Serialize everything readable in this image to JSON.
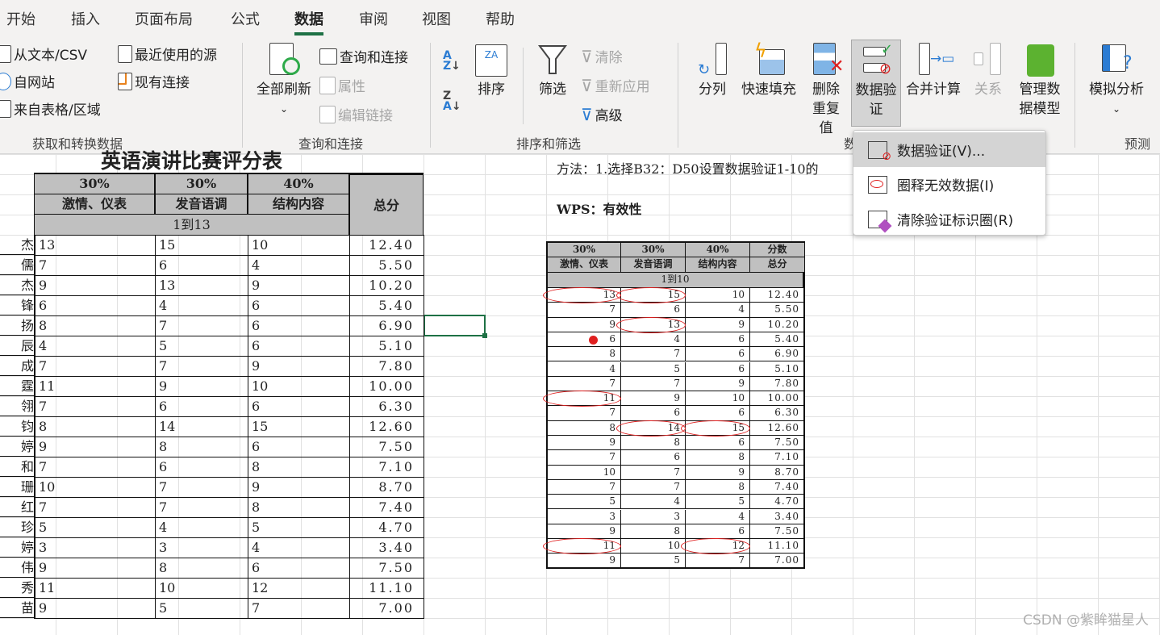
{
  "tabs": [
    "开始",
    "插入",
    "页面布局",
    "公式",
    "数据",
    "审阅",
    "视图",
    "帮助"
  ],
  "active_tab": "数据",
  "ribbon": {
    "get_transform": {
      "label": "获取和转换数据",
      "items": [
        "从文本/CSV",
        "自网站",
        "来自表格/区域",
        "最近使用的源",
        "现有连接"
      ]
    },
    "queries": {
      "label": "查询和连接",
      "refresh_all": "全部刷新",
      "items": [
        "查询和连接",
        "属性",
        "编辑链接"
      ]
    },
    "sort_filter": {
      "label": "排序和筛选",
      "sort": "排序",
      "filter": "筛选",
      "clear": "清除",
      "reapply": "重新应用",
      "advanced": "高级"
    },
    "data_tools": {
      "label": "数",
      "text_to_columns": "分列",
      "flash_fill": "快速填充",
      "remove_dup": "删除重复值",
      "data_validation": "数据验证",
      "consolidate": "合并计算",
      "relationships": "关系",
      "data_model": "管理数据模型"
    },
    "forecast": {
      "label": "预测",
      "what_if": "模拟分析"
    }
  },
  "dropdown": {
    "items": [
      "数据验证(V)...",
      "圈释无效数据(I)",
      "清除验证标识圈(R)"
    ]
  },
  "left_table": {
    "title": "英语演讲比赛评分表",
    "weights": [
      "30%",
      "30%",
      "40%"
    ],
    "headers": [
      "激情、仪表",
      "发音语调",
      "结构内容"
    ],
    "total_header": "总分",
    "range": "1到13",
    "names": [
      "杰",
      "儒",
      "杰",
      "锋",
      "扬",
      "辰",
      "成",
      "霆",
      "翎",
      "钧",
      "婷",
      "和",
      "珊",
      "红",
      "珍",
      "婷",
      "伟",
      "秀",
      "苗"
    ],
    "rows": [
      [
        "13",
        "15",
        "10",
        "12.40"
      ],
      [
        "7",
        "6",
        "4",
        "5.50"
      ],
      [
        "9",
        "13",
        "9",
        "10.20"
      ],
      [
        "6",
        "4",
        "6",
        "5.40"
      ],
      [
        "8",
        "7",
        "6",
        "6.90"
      ],
      [
        "4",
        "5",
        "6",
        "5.10"
      ],
      [
        "7",
        "7",
        "9",
        "7.80"
      ],
      [
        "11",
        "9",
        "10",
        "10.00"
      ],
      [
        "7",
        "6",
        "6",
        "6.30"
      ],
      [
        "8",
        "14",
        "15",
        "12.60"
      ],
      [
        "9",
        "8",
        "6",
        "7.50"
      ],
      [
        "7",
        "6",
        "8",
        "7.10"
      ],
      [
        "10",
        "7",
        "9",
        "8.70"
      ],
      [
        "7",
        "7",
        "8",
        "7.40"
      ],
      [
        "5",
        "4",
        "5",
        "4.70"
      ],
      [
        "3",
        "3",
        "4",
        "3.40"
      ],
      [
        "9",
        "8",
        "6",
        "7.50"
      ],
      [
        "11",
        "10",
        "12",
        "11.10"
      ],
      [
        "9",
        "5",
        "7",
        "7.00"
      ]
    ]
  },
  "note": "方法：1.选择B32：D50设置数据验证1-10的",
  "wps_note": "WPS：有效性",
  "right_table": {
    "weights": [
      "30%",
      "30%",
      "40%",
      "分数"
    ],
    "headers": [
      "激情、仪表",
      "发音语调",
      "结构内容",
      "总分"
    ],
    "range": "1到10",
    "rows": [
      [
        "13",
        "15",
        "10",
        "12.40"
      ],
      [
        "7",
        "6",
        "4",
        "5.50"
      ],
      [
        "9",
        "13",
        "9",
        "10.20"
      ],
      [
        "6",
        "4",
        "6",
        "5.40"
      ],
      [
        "8",
        "7",
        "6",
        "6.90"
      ],
      [
        "4",
        "5",
        "6",
        "5.10"
      ],
      [
        "7",
        "7",
        "9",
        "7.80"
      ],
      [
        "11",
        "9",
        "10",
        "10.00"
      ],
      [
        "7",
        "6",
        "6",
        "6.30"
      ],
      [
        "8",
        "14",
        "15",
        "12.60"
      ],
      [
        "9",
        "8",
        "6",
        "7.50"
      ],
      [
        "7",
        "6",
        "8",
        "7.10"
      ],
      [
        "10",
        "7",
        "9",
        "8.70"
      ],
      [
        "7",
        "7",
        "8",
        "7.40"
      ],
      [
        "5",
        "4",
        "5",
        "4.70"
      ],
      [
        "3",
        "3",
        "4",
        "3.40"
      ],
      [
        "9",
        "8",
        "6",
        "7.50"
      ],
      [
        "11",
        "10",
        "12",
        "11.10"
      ],
      [
        "9",
        "5",
        "7",
        "7.00"
      ]
    ],
    "circled_invalid": [
      [
        0,
        0
      ],
      [
        0,
        1
      ],
      [
        2,
        1
      ],
      [
        7,
        0
      ],
      [
        9,
        1
      ],
      [
        9,
        2
      ],
      [
        17,
        0
      ],
      [
        17,
        2
      ]
    ]
  },
  "watermark": "CSDN @紫眸猫星人",
  "colors": {
    "accent": "#1e7145",
    "circle": "#e02020",
    "header_fill": "#c0c0c0"
  }
}
